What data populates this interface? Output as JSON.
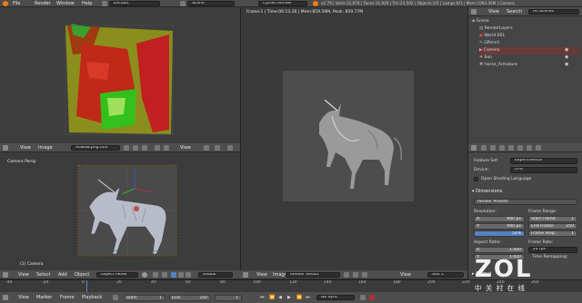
{
  "topbar": {
    "menus": [
      "File",
      "Render",
      "Window",
      "Help"
    ],
    "screen_layout": "Default",
    "scene": "Scene",
    "engine": "Cycles Render",
    "stats": "v2.79 | Verts:11,676 | Faces:11,929 | Tris:23,592 | Objects:1/5 | Lamps:0/1 | Mem:1093.45M | Camera"
  },
  "render_view": {
    "status": "Frame:1 | Time:00:13.26 | Mem:859.59M, Peak: 859.77M"
  },
  "uv_editor": {
    "header": {
      "view": "View",
      "image": "Image",
      "image_name": "Aowaw.png.000",
      "view2": "View"
    }
  },
  "viewport_3d": {
    "label": "Camera Persp",
    "object_label": "(1) Camera",
    "header": {
      "view": "View",
      "select": "Select",
      "add": "Add",
      "object": "Object",
      "mode": "Object Mode",
      "pivot": "Global"
    }
  },
  "image_editor_header": {
    "view": "View",
    "image": "Image",
    "image_name": "Render Result",
    "view2": "View",
    "slot": "Slot 1"
  },
  "outliner": {
    "header": {
      "view": "View",
      "search": "Search",
      "scope": "All Scenes"
    },
    "items": [
      {
        "label": "Scene",
        "indent": 0
      },
      {
        "label": "RenderLayers",
        "indent": 1
      },
      {
        "label": "World.001",
        "indent": 1
      },
      {
        "label": "GPencil",
        "indent": 1
      },
      {
        "label": "Camera",
        "indent": 1
      },
      {
        "label": "Sun",
        "indent": 1
      },
      {
        "label": "horse_Armature",
        "indent": 1
      }
    ]
  },
  "properties": {
    "feature_set_label": "Feature Set:",
    "feature_set": "Experimental",
    "device_label": "Device:",
    "device": "CPU",
    "open_shading_language": "Open Shading Language",
    "dimensions": "Dimensions",
    "render_presets": "Render Presets",
    "resolution_label": "Resolution:",
    "res_x_label": "X:",
    "res_x": "900 px",
    "res_y_label": "Y:",
    "res_y": "900 px",
    "res_pct": "54%",
    "frame_range_label": "Frame Range:",
    "start_frame_label": "Start Frame:",
    "start_frame": "1",
    "end_frame_label": "End Frame:",
    "end_frame": "250",
    "frame_step_label": "Frame Step:",
    "frame_step": "1",
    "aspect_label": "Aspect Ratio:",
    "aspect_x_label": "X:",
    "aspect_x": "1.000",
    "aspect_y_label": "Y:",
    "aspect_y": "1.000",
    "frame_rate_label": "Frame Rate:",
    "frame_rate": "24 fps",
    "time_remapping": "Time Remapping:",
    "output": "Output"
  },
  "timeline": {
    "ticks": [
      "-40",
      "-20",
      "0",
      "20",
      "40",
      "60",
      "80",
      "100",
      "120",
      "140",
      "160",
      "180",
      "200",
      "220",
      "240",
      "260"
    ],
    "menu": [
      "View",
      "Marker",
      "Frame",
      "Playback"
    ],
    "start_label": "Start:",
    "start": "1",
    "end_label": "End:",
    "end": "250",
    "current": "1",
    "sync": "No Sync"
  },
  "watermark": {
    "brand": "ZOL",
    "sub": "中 关 村 在 线"
  },
  "colors": {
    "accent": "#5680c2",
    "background": "#3a3a3a",
    "header": "#545454"
  }
}
